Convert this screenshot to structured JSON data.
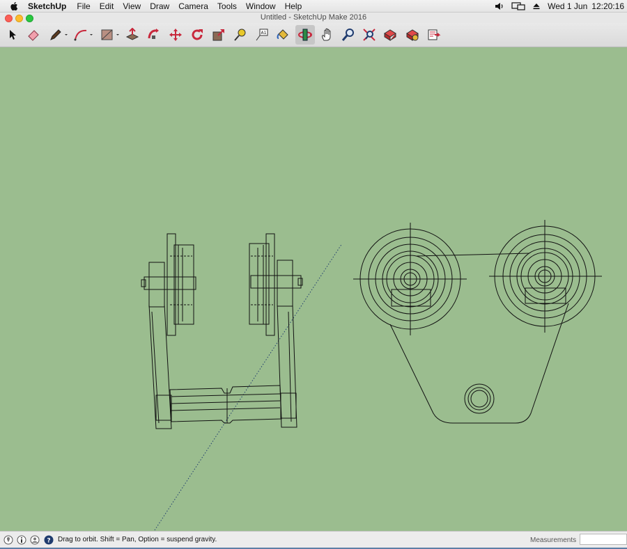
{
  "menubar": {
    "app_name": "SketchUp",
    "items": [
      "File",
      "Edit",
      "View",
      "Draw",
      "Camera",
      "Tools",
      "Window",
      "Help"
    ],
    "date": "Wed 1 Jun",
    "time": "12:20:16"
  },
  "window": {
    "title": "Untitled - SketchUp Make 2016"
  },
  "toolbar": {
    "tools": [
      "select",
      "eraser",
      "pencil",
      "arc",
      "rectangle",
      "push-pull",
      "follow-me",
      "move",
      "rotate",
      "scale",
      "tape-measure",
      "text",
      "paint-bucket",
      "orbit",
      "pan",
      "zoom",
      "zoom-extents",
      "3d-warehouse",
      "extension-warehouse",
      "send-to-layout"
    ],
    "selected": "orbit"
  },
  "status": {
    "hint": "Drag to orbit. Shift = Pan, Option = suspend gravity.",
    "measurements_label": "Measurements",
    "measurements_value": ""
  },
  "colors": {
    "canvas": "#9bbd8f",
    "line": "#111111",
    "axis": "#1f3b6e"
  }
}
